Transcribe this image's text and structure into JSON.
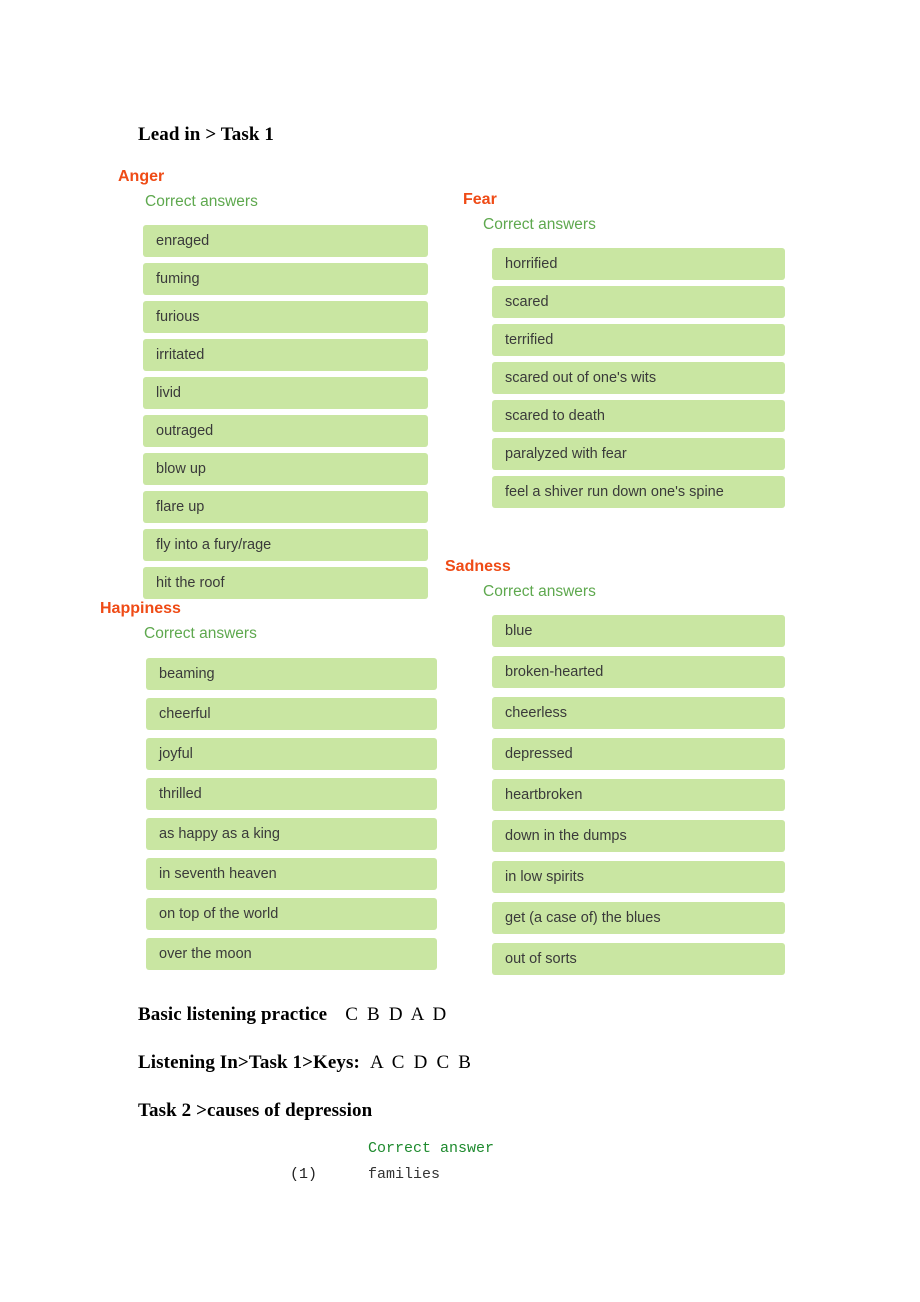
{
  "document": {
    "heading": "Lead in > Task 1",
    "sections": [
      {
        "name": "Anger",
        "label": "Correct answers",
        "items": [
          "enraged",
          "fuming",
          "furious",
          "irritated",
          "livid",
          "outraged",
          "blow up",
          "flare up",
          "fly into a fury/rage",
          "hit the roof"
        ]
      },
      {
        "name": "Fear",
        "label": "Correct answers",
        "items": [
          "horrified",
          "scared",
          "terrified",
          "scared out of one's wits",
          "scared to death",
          "paralyzed with fear",
          "feel a shiver run down one's spine"
        ]
      },
      {
        "name": "Happiness",
        "label": "Correct answers",
        "items": [
          "beaming",
          "cheerful",
          "joyful",
          "thrilled",
          "as happy as a king",
          "in seventh heaven",
          "on top of the world",
          "over the moon"
        ]
      },
      {
        "name": "Sadness",
        "label": "Correct answers",
        "items": [
          "blue",
          "broken-hearted",
          "cheerless",
          "depressed",
          "heartbroken",
          "down in the dumps",
          "in low spirits",
          "get (a case of) the blues",
          "out of sorts"
        ]
      }
    ],
    "answer_lines": [
      {
        "label": "Basic listening practice",
        "answers": "C B D A D"
      },
      {
        "label": "Listening In>Task 1>Keys:",
        "answers": "A C D C B"
      },
      {
        "label": "Task 2 >causes of depression",
        "answers": ""
      }
    ],
    "task2": {
      "header": "Correct answer",
      "rows": [
        {
          "index": "(1)",
          "value": "families"
        }
      ]
    }
  },
  "colors": {
    "emotion_title": "#ef4b16",
    "correct_answers_label": "#5ea84e",
    "answer_chip_bg": "#c9e6a2",
    "answer_text": "#3a3a3a",
    "mono_header": "#1e8a2e",
    "page_bg": "#ffffff"
  }
}
